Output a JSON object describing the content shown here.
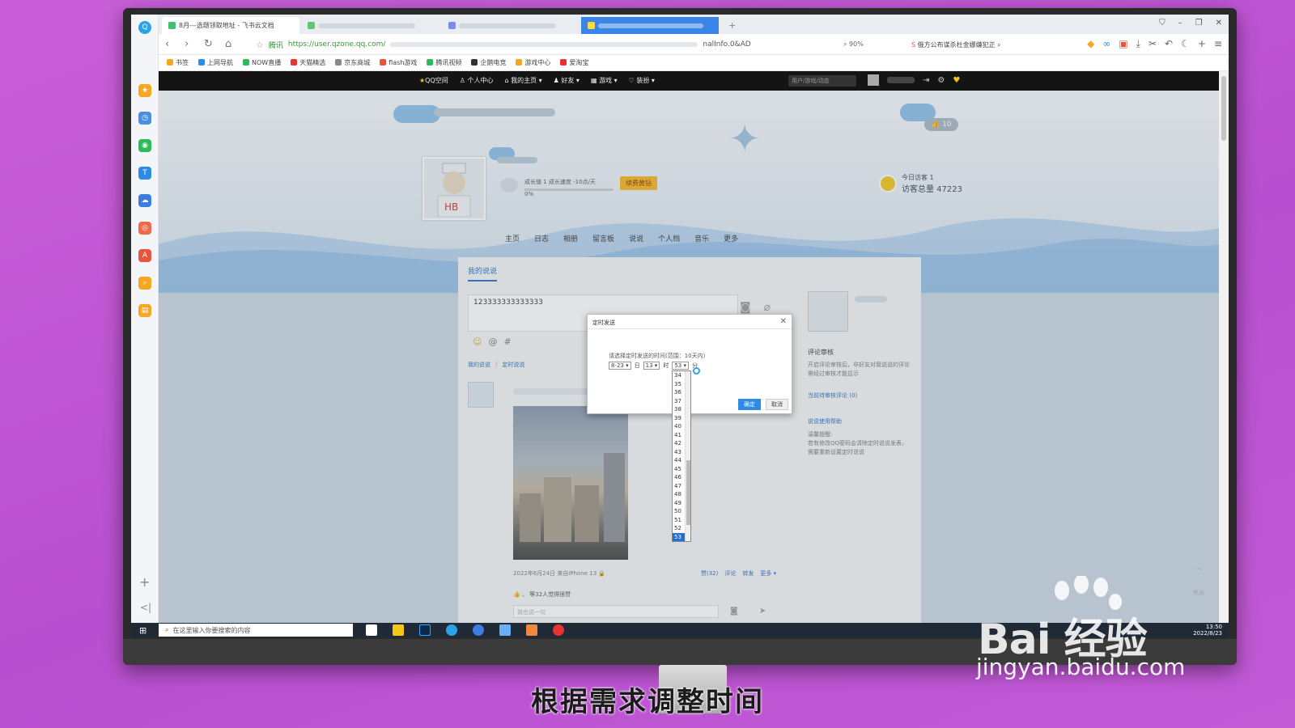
{
  "browser": {
    "tabs": [
      {
        "label": "8月---选题领取地址 - 飞书云文档",
        "color": "#3fbf6f"
      },
      {
        "label": "",
        "color": "#66c27a"
      },
      {
        "label": "",
        "color": "#7a8cf0"
      },
      {
        "label": "",
        "color": "#4aa3ff"
      }
    ],
    "url_site": "腾讯",
    "url": "https://user.qzone.qq.com/",
    "url_tail": "nalInfo.0&AD",
    "zoom": "90%",
    "news": "俄方公布谋杀杜金娜嫌犯正",
    "bookmarks": [
      "书签",
      "上网导航",
      "NOW直播",
      "天猫精选",
      "京东商城",
      "flash游戏",
      "腾讯视频",
      "企鹅电竞",
      "游戏中心",
      "爱淘宝"
    ]
  },
  "qzone": {
    "top_menu": [
      "QQ空间",
      "个人中心",
      "我的主页",
      "好友",
      "游戏",
      "装扮"
    ],
    "search_placeholder": "用户/游戏/动态",
    "growth_text": "成长值 1  成长速度 -10点/天",
    "growth_pct": "0%",
    "vip_label": "续费黄钻",
    "visitors_today": "今日访客 1",
    "visitors_total": "访客总量 47223",
    "likes": "10",
    "nav": [
      "主页",
      "日志",
      "相册",
      "留言板",
      "说说",
      "个人档",
      "音乐",
      "更多"
    ],
    "panel_title": "我的说说",
    "editor_text": "123333333333333",
    "sub_tabs": [
      "我的说说",
      "|",
      "定时说说"
    ],
    "post_meta": "2022年6月24日  来自iPhone 13",
    "post_actions": [
      "赞(32)",
      "评论",
      "转发",
      "更多"
    ],
    "post_likes": "等32人觉得很赞",
    "comment_placeholder": "我也说一句",
    "side_title": "评论审核",
    "side_text": "开启评论审核后，非好友对我说说的评论需经过审核才能显示",
    "side_link1": "当前待审核评论 (0)",
    "side_link2": "说说使用帮助",
    "side_tip_title": "温馨提醒:",
    "side_tip": "若有修改QQ密码会清除定时说说发表，需要重新设置定时说说",
    "hot": "热点"
  },
  "dialog": {
    "title": "定时发送",
    "prompt": "请选择定时发送的时间(范围：10天内)",
    "date_value": "8-23",
    "day_label": "日",
    "hour_value": "13",
    "hour_label": "时",
    "minute_value": "53",
    "minute_label": "分",
    "ok": "确定",
    "cancel": "取消",
    "minute_options": [
      "34",
      "35",
      "36",
      "37",
      "38",
      "39",
      "40",
      "41",
      "42",
      "43",
      "44",
      "45",
      "46",
      "47",
      "48",
      "49",
      "50",
      "51",
      "52",
      "53"
    ],
    "selected_minute": "53"
  },
  "taskbar": {
    "search_placeholder": "在这里输入你要搜索的内容",
    "time": "13:50",
    "date": "2022/8/23"
  },
  "watermark": {
    "logo": "Bai 经验",
    "url": "jingyan.baidu.com"
  },
  "caption": "根据需求调整时间"
}
